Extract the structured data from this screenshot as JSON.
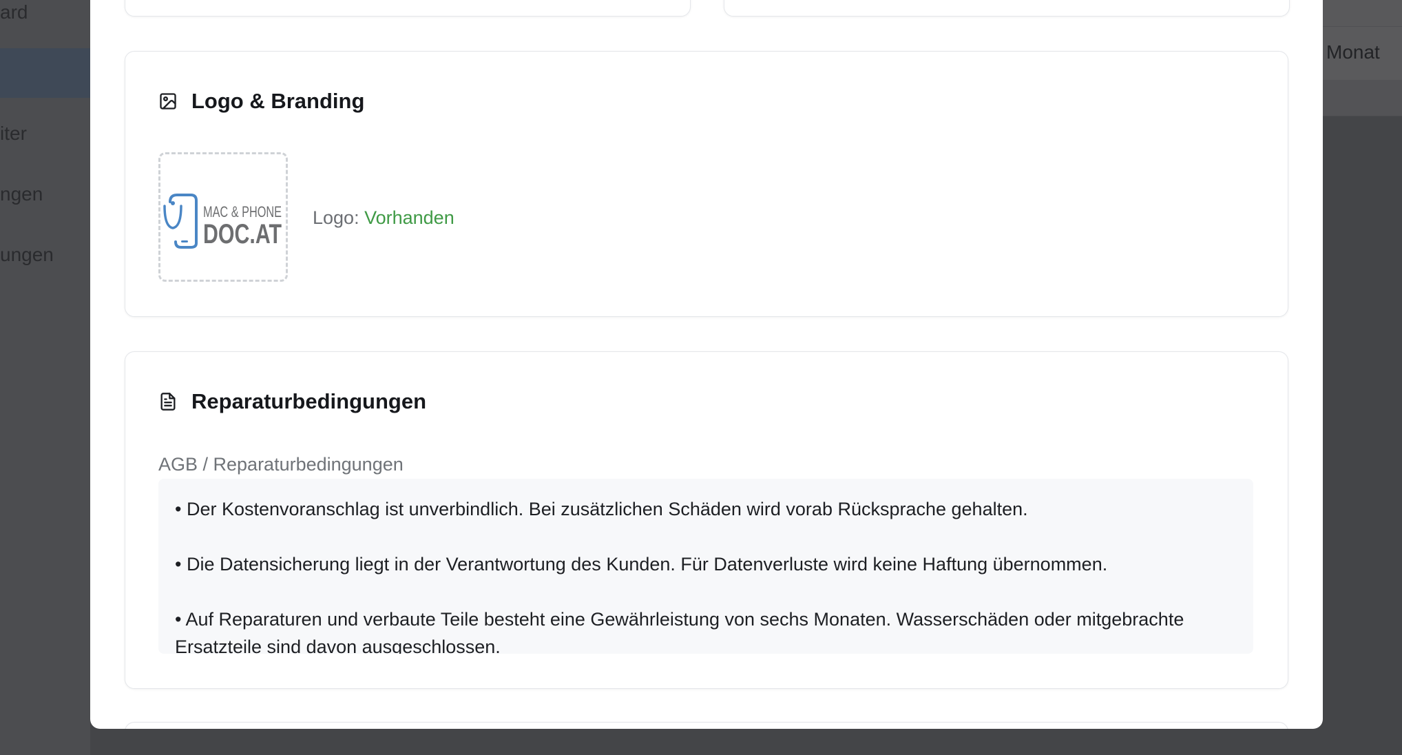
{
  "background": {
    "nav_fragments": [
      "ard",
      "iter",
      "ngen",
      "ungen"
    ],
    "right_label": "Monat"
  },
  "logo_section": {
    "title": "Logo & Branding",
    "icon": "image-icon",
    "logo_text_line1": "MAC & PHONE",
    "logo_text_line2": "DOC.AT",
    "status_label": "Logo:",
    "status_value": "Vorhanden",
    "status_color": "#3f9a45"
  },
  "terms_section": {
    "title": "Reparaturbedingungen",
    "icon": "document-icon",
    "field_label": "AGB / Reparaturbedingungen",
    "terms": [
      "• Der Kostenvoranschlag ist unverbindlich. Bei zusätzlichen Schäden wird vorab Rücksprache gehalten.",
      "• Die Datensicherung liegt in der Verantwortung des Kunden. Für Datenverluste wird keine Haftung übernommen.",
      "• Auf Reparaturen und verbaute Teile besteht eine Gewährleistung von sechs Monaten. Wasserschäden oder mitgebrachte Ersatzteile sind davon ausgeschlossen."
    ]
  },
  "colors": {
    "overlay": "#444548",
    "card_border": "#e4e6ea",
    "logo_blue": "#4a86c5",
    "logo_gray": "#6d6e70"
  }
}
